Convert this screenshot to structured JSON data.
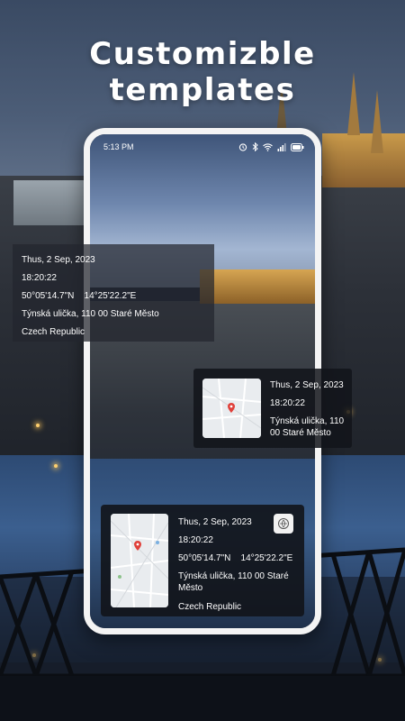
{
  "headline": "Customizble templates",
  "statusbar": {
    "time": "5:13 PM",
    "icons": [
      "alarm-icon",
      "bluetooth-icon",
      "wifi-icon",
      "signal-icon",
      "battery-icon"
    ]
  },
  "card_a": {
    "date": "Thus, 2 Sep, 2023",
    "time": "18:20:22",
    "coordinates": "50°05'14.7\"N    14°25'22.2\"E",
    "address": "Týnská ulička, 110 00 Staré Město",
    "country": "Czech Republic"
  },
  "card_b": {
    "date": "Thus, 2 Sep, 2023",
    "time": "18:20:22",
    "address": "Týnská ulička, 110 00 Staré Město"
  },
  "card_c": {
    "date": "Thus, 2 Sep, 2023",
    "time": "18:20:22",
    "coordinates": "50°05'14.7\"N    14°25'22.2\"E",
    "address": "Týnská ulička, 110 00 Staré Město",
    "country": "Czech Republic",
    "badge_icon": "location-badge-icon"
  },
  "colors": {
    "phone_frame": "#f4f4f4",
    "map_pin": "#e0403a",
    "map_background": "#e9ecef"
  }
}
